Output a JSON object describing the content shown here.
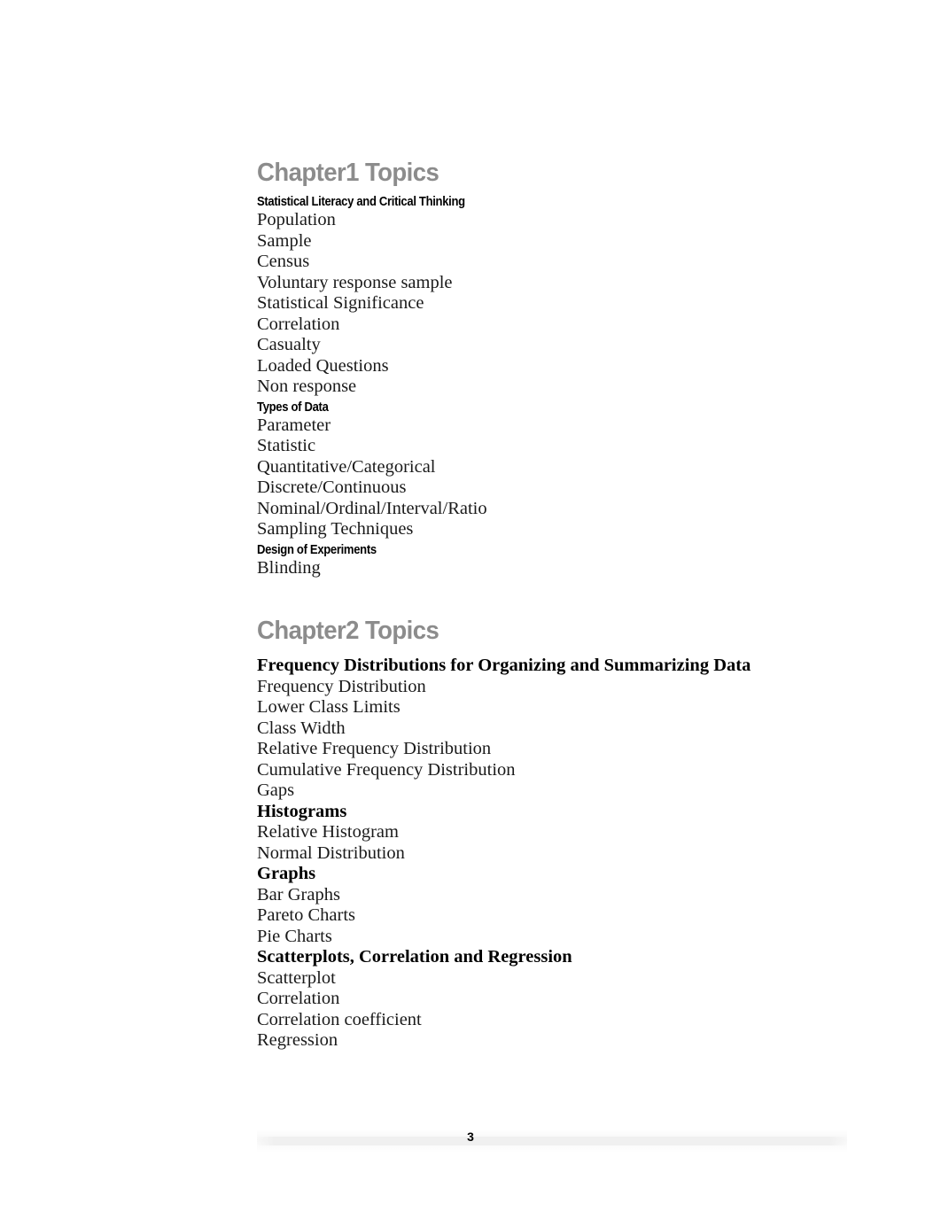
{
  "document": {
    "page_number": "3"
  },
  "chapters": [
    {
      "heading": "Chapter1 Topics",
      "subhead_style": "sans-condensed",
      "sections": [
        {
          "title": "Statistical Literacy and Critical Thinking",
          "items": [
            "Population",
            "Sample",
            "Census",
            "Voluntary response sample",
            "Statistical Significance",
            "Correlation",
            "Casualty",
            "Loaded Questions",
            "Non response"
          ]
        },
        {
          "title": "Types of Data",
          "items": [
            "Parameter",
            "Statistic",
            "Quantitative/Categorical",
            "Discrete/Continuous",
            "Nominal/Ordinal/Interval/Ratio",
            "Sampling Techniques"
          ]
        },
        {
          "title": "Design of Experiments",
          "items": [
            "Blinding"
          ]
        }
      ]
    },
    {
      "heading": "Chapter2 Topics",
      "subhead_style": "serif-bold",
      "sections": [
        {
          "title": "Frequency Distributions for Organizing and Summarizing Data",
          "items": [
            "Frequency Distribution",
            "Lower Class Limits",
            "Class Width",
            "Relative Frequency Distribution",
            "Cumulative Frequency Distribution",
            "Gaps"
          ]
        },
        {
          "title": "Histograms",
          "items": [
            "Relative Histogram",
            "Normal Distribution"
          ]
        },
        {
          "title": "Graphs",
          "items": [
            "Bar Graphs",
            "Pareto Charts",
            "Pie Charts"
          ]
        },
        {
          "title": "Scatterplots, Correlation and Regression",
          "items": [
            "Scatterplot",
            "Correlation",
            "Correlation coefficient",
            "Regression"
          ]
        }
      ]
    }
  ],
  "colors": {
    "heading_gray": "#8c8c8c",
    "body_text": "#1a1a1a",
    "page_background": "#ffffff"
  }
}
